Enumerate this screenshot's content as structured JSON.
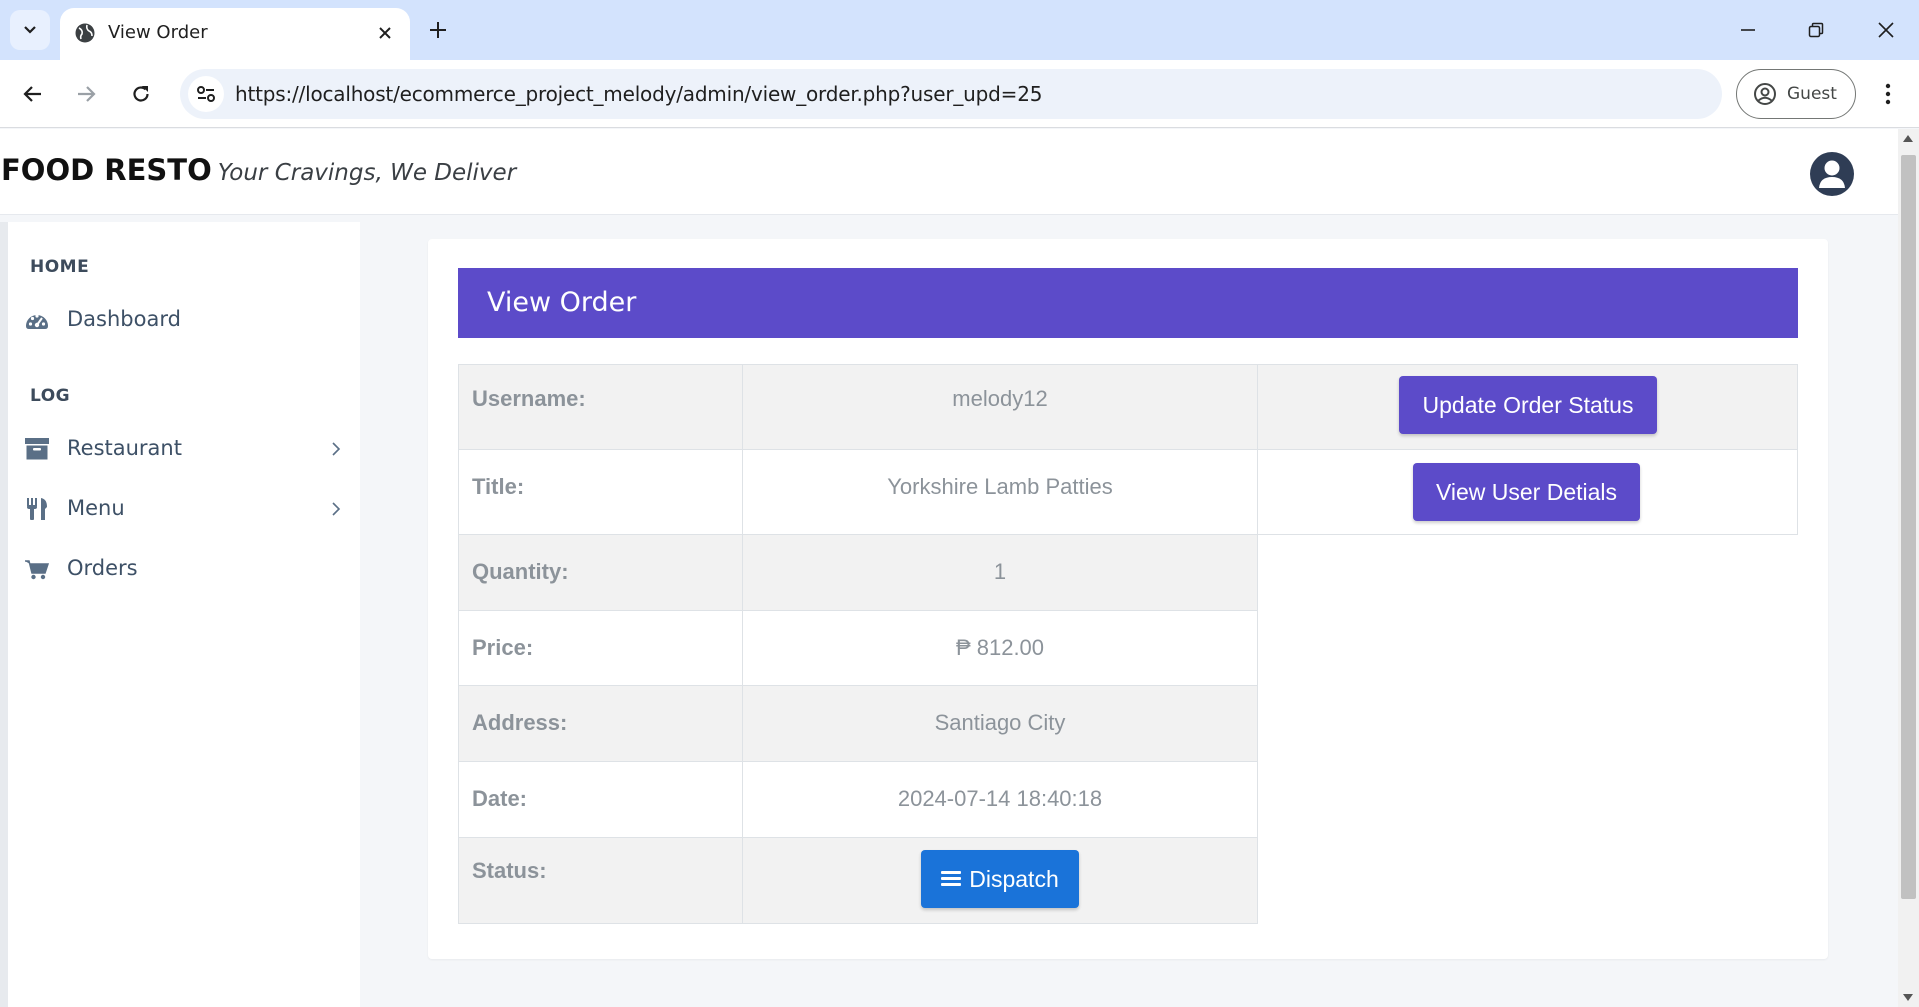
{
  "browser": {
    "tab_title": "View Order",
    "url": "https://localhost/ecommerce_project_melody/admin/view_order.php?user_upd=25",
    "profile_label": "Guest"
  },
  "topbar": {
    "brand_name": "FOOD RESTO",
    "brand_tagline": "Your Cravings, We Deliver"
  },
  "sidebar": {
    "sections": [
      {
        "title": "HOME",
        "items": [
          {
            "label": "Dashboard",
            "icon": "tachometer-icon"
          }
        ]
      },
      {
        "title": "LOG",
        "items": [
          {
            "label": "Restaurant",
            "icon": "archive-icon",
            "has_submenu": true
          },
          {
            "label": "Menu",
            "icon": "cutlery-icon",
            "has_submenu": true
          },
          {
            "label": "Orders",
            "icon": "cart-icon"
          }
        ]
      }
    ]
  },
  "card": {
    "title": "View Order",
    "colors": {
      "header": "#5c4bc9",
      "primary_button": "#5c4bc9",
      "status_button": "#1a73d9"
    }
  },
  "order": {
    "rows": [
      {
        "label": "Username:",
        "value": "melody12"
      },
      {
        "label": "Title:",
        "value": "Yorkshire Lamb Patties"
      },
      {
        "label": "Quantity:",
        "value": "1"
      },
      {
        "label": "Price:",
        "value": "₱ 812.00"
      },
      {
        "label": "Address:",
        "value": "Santiago City"
      },
      {
        "label": "Date:",
        "value": "2024-07-14 18:40:18"
      },
      {
        "label": "Status:",
        "value": "Dispatch"
      }
    ],
    "actions": {
      "update_status": "Update Order Status",
      "view_user": "View User Detials"
    }
  }
}
